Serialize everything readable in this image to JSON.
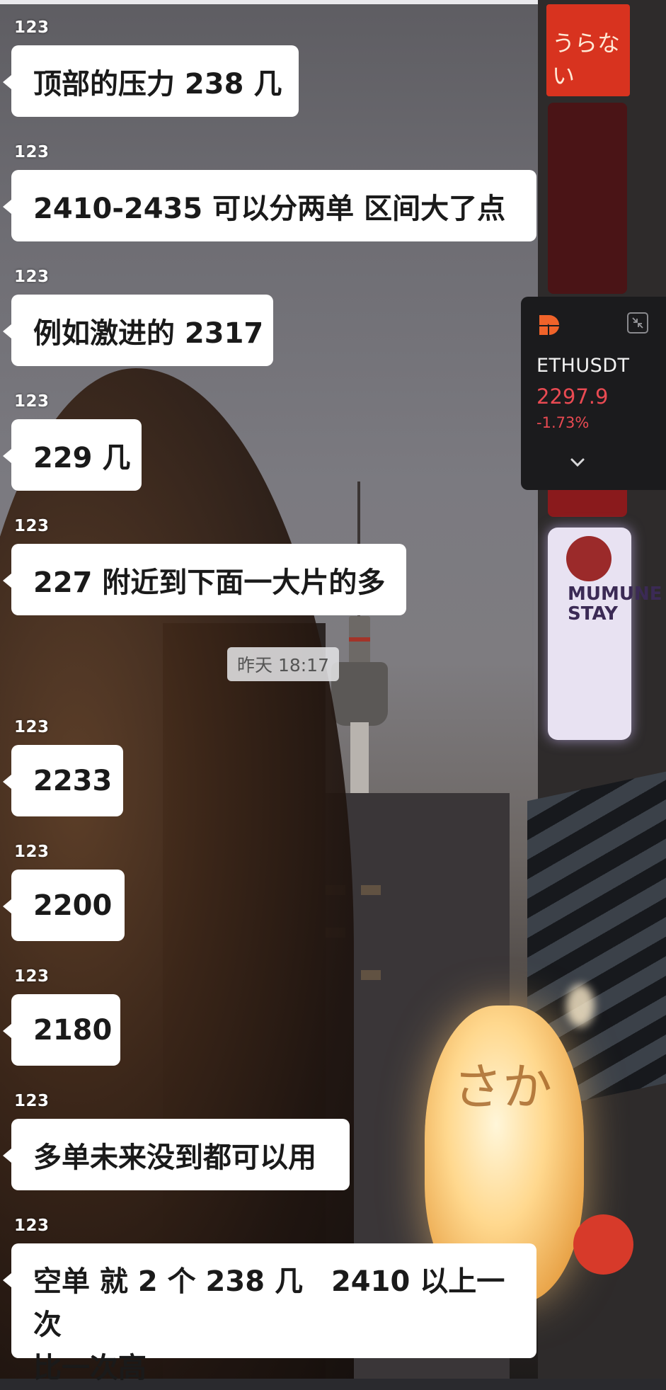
{
  "messages": [
    {
      "sender": "123",
      "text": "顶部的压力 238 几"
    },
    {
      "sender": "123",
      "text": "2410-2435 可以分两单 区间大了点"
    },
    {
      "sender": "123",
      "text": "例如激进的 2317"
    },
    {
      "sender": "123",
      "text": "229 几"
    },
    {
      "sender": "123",
      "text": "227 附近到下面一大片的多"
    },
    {
      "sender": "123",
      "text": "2233"
    },
    {
      "sender": "123",
      "text": "2200"
    },
    {
      "sender": "123",
      "text": "2180"
    },
    {
      "sender": "123",
      "text": "多单未来没到都可以用"
    },
    {
      "sender": "123",
      "text_line1": "空单 就 2 个 238 几　2410 以上一次",
      "text_line2": "比一次高"
    }
  ],
  "timestamp": "昨天 18:17",
  "ticker": {
    "symbol": "ETHUSDT",
    "price": "2297.9",
    "change": "-1.73%",
    "logo_icon": "exchange-logo-icon",
    "collapse_icon": "collapse-icon",
    "expand_icon": "chevron-down-icon",
    "price_color": "#e94a52",
    "logo_color": "#f0632a"
  },
  "scene": {
    "sign_text": "うらない",
    "sign_letters": "MUMUNE STAY",
    "lantern_text": "さか"
  }
}
